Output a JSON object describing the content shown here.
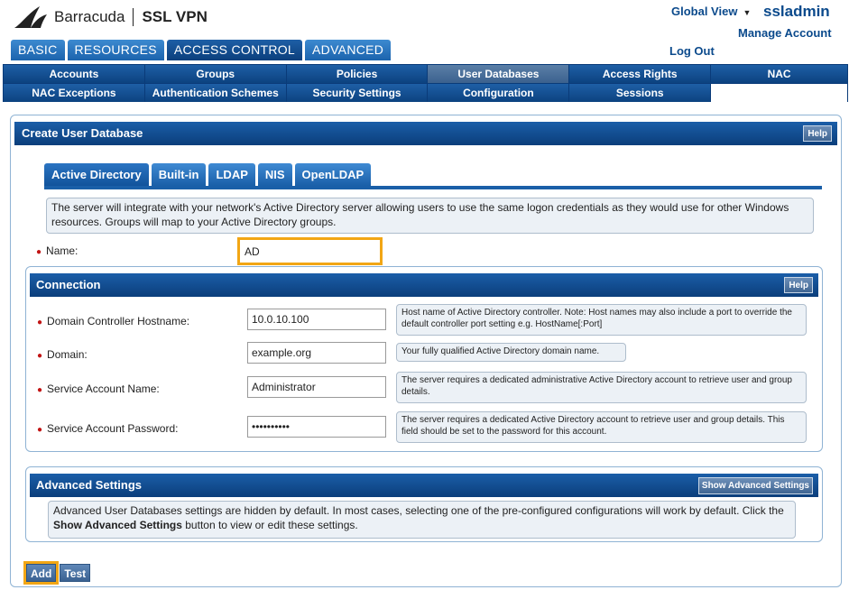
{
  "header": {
    "brand": "Barracuda",
    "product": "SSL VPN",
    "global_view": "Global View",
    "username": "ssladmin",
    "manage_account": "Manage Account",
    "logout": "Log Out"
  },
  "main_tabs": [
    "BASIC",
    "RESOURCES",
    "ACCESS CONTROL",
    "ADVANCED"
  ],
  "sub_nav": {
    "row1": [
      "Accounts",
      "Groups",
      "Policies",
      "User Databases",
      "Access Rights",
      "NAC"
    ],
    "row2": [
      "NAC Exceptions",
      "Authentication Schemes",
      "Security Settings",
      "Configuration",
      "Sessions"
    ]
  },
  "panel": {
    "title": "Create User Database",
    "help": "Help",
    "db_tabs": [
      "Active Directory",
      "Built-in",
      "LDAP",
      "NIS",
      "OpenLDAP"
    ],
    "description": "The server will integrate with your network's Active Directory server allowing users to use the same logon credentials as they would use for other Windows resources. Groups will map to your Active Directory groups.",
    "name_label": "Name:",
    "name_value": "AD"
  },
  "connection": {
    "title": "Connection",
    "help": "Help",
    "fields": {
      "hostname": {
        "label": "Domain Controller Hostname:",
        "value": "10.0.10.100",
        "hint": "Host name of Active Directory controller. Note: Host names may also include a port to override the default controller port setting e.g. HostName[:Port]"
      },
      "domain": {
        "label": "Domain:",
        "value": "example.org",
        "hint": "Your fully qualified Active Directory domain name."
      },
      "account": {
        "label": "Service Account Name:",
        "value": "Administrator",
        "hint": "The server requires a dedicated administrative Active Directory account to retrieve user and group details."
      },
      "password": {
        "label": "Service Account Password:",
        "value": "••••••••••",
        "hint": "The server requires a dedicated Active Directory account to retrieve user and group details. This field should be set to the password for this account."
      }
    }
  },
  "advanced": {
    "title": "Advanced Settings",
    "show_button": "Show Advanced Settings",
    "text_before": "Advanced User Databases settings are hidden by default. In most cases, selecting one of the pre-configured configurations will work by default. Click the ",
    "text_bold": "Show Advanced Settings",
    "text_after": " button to view or edit these settings."
  },
  "actions": {
    "add": "Add",
    "test": "Test"
  }
}
